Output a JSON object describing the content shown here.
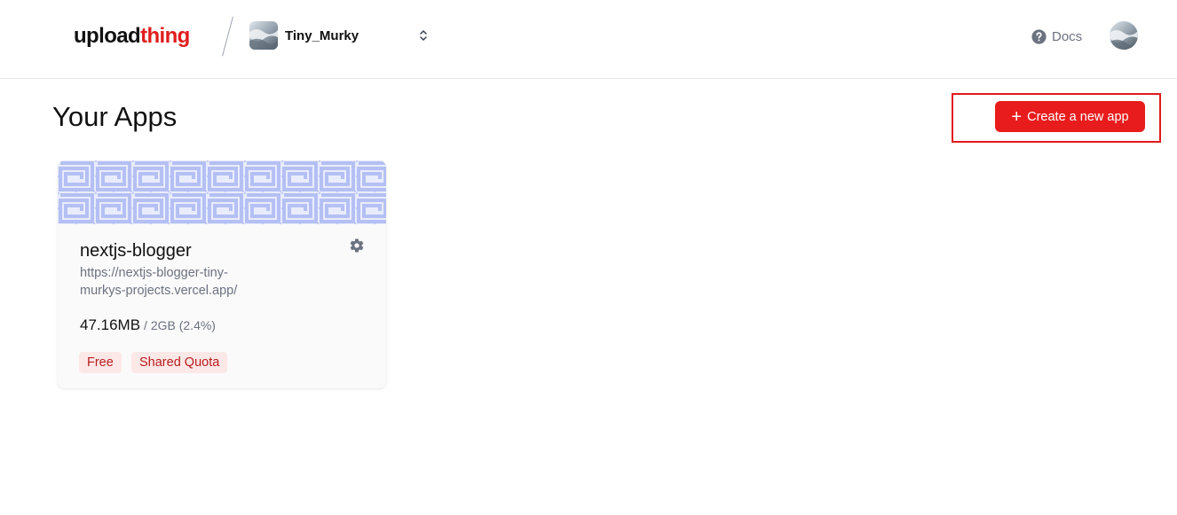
{
  "header": {
    "logo_part1": "upload",
    "logo_part2": "thing",
    "team_name": "Tiny_Murky",
    "docs_label": "Docs"
  },
  "main": {
    "title": "Your Apps",
    "create_button_label": "Create a new app",
    "apps": [
      {
        "name": "nextjs-blogger",
        "url": "https://nextjs-blogger-tiny-murkys-projects.vercel.app/",
        "usage": "47.16MB",
        "usage_limit": "/ 2GB (2.4%)",
        "badges": [
          "Free",
          "Shared Quota"
        ]
      }
    ]
  },
  "colors": {
    "brand_red": "#e11d1d",
    "button_red": "#e81c1c",
    "highlight_border": "#e01b1b",
    "badge_bg": "#fde8e8",
    "badge_text": "#b91c1c",
    "pattern_blue": "#b4c0f4"
  },
  "icons": {
    "team_chevron": "chevron-up-down-icon",
    "docs": "question-circle-icon",
    "settings": "gear-icon",
    "create": "plus-icon"
  }
}
